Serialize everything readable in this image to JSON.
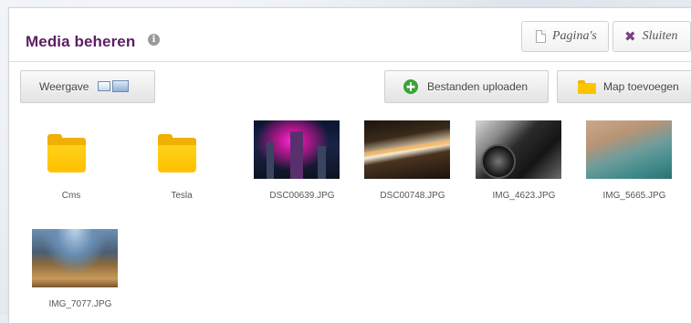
{
  "header": {
    "title": "Media beheren",
    "info_icon": "info-icon",
    "paginas_label": "Pagina's",
    "paginas_icon": "page-icon",
    "sluiten_label": "Sluiten",
    "sluiten_icon": "close-icon"
  },
  "toolbar": {
    "weergave_label": "Weergave",
    "upload_label": "Bestanden uploaden",
    "add_folder_label": "Map toevoegen"
  },
  "colors": {
    "title": "#5b1f62",
    "folder": "#ffc400",
    "upload_icon": "#3aa335"
  },
  "items": [
    {
      "name": "Cms",
      "type": "folder"
    },
    {
      "name": "Tesla",
      "type": "folder"
    },
    {
      "name": "DSC00639.JPG",
      "type": "image"
    },
    {
      "name": "DSC00748.JPG",
      "type": "image"
    },
    {
      "name": "IMG_4623.JPG",
      "type": "image"
    },
    {
      "name": "IMG_5665.JPG",
      "type": "image"
    },
    {
      "name": "IMG_7077.JPG",
      "type": "image"
    }
  ]
}
